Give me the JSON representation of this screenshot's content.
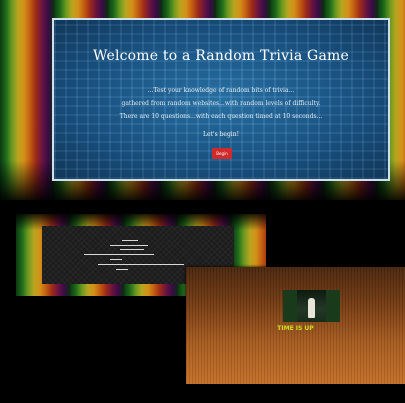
{
  "welcome": {
    "title": "Welcome to a Random Trivia Game",
    "intro_line1": "...Test your knowledge of random bits of trivia...",
    "intro_line2": "gathered from random websites...with random levels of difficulty.",
    "intro_line3": "There are 10 questions...with each question timed at 10 seconds...",
    "lets_begin": "Let's begin!",
    "begin_button": "Begin"
  },
  "time_up": {
    "title": "TIME IS UP"
  },
  "colors": {
    "panel_blue": "#1d5e94",
    "begin_red": "#d02a2a",
    "timeup_yellow": "#c8e020"
  }
}
